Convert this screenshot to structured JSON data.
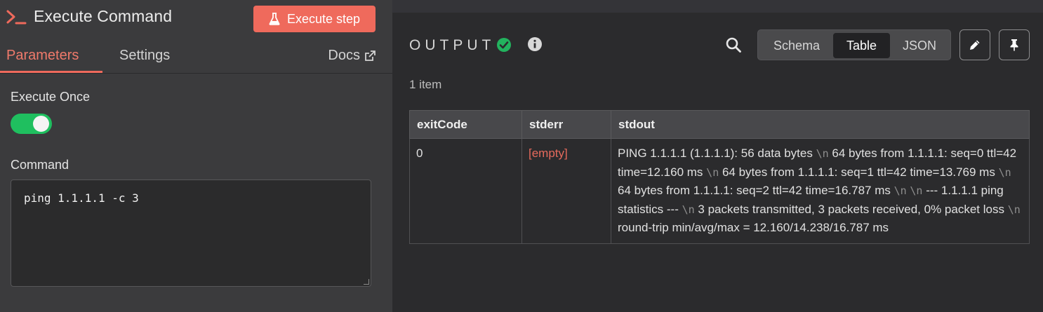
{
  "node": {
    "title": "Execute Command",
    "execute_button": "Execute step"
  },
  "tabs": {
    "parameters": "Parameters",
    "settings": "Settings",
    "docs": "Docs"
  },
  "params": {
    "execute_once_label": "Execute Once",
    "execute_once_enabled": true,
    "command_label": "Command",
    "command_value": "ping 1.1.1.1 -c 3"
  },
  "output": {
    "title": "OUTPUT",
    "views": [
      "Schema",
      "Table",
      "JSON"
    ],
    "active_view": "Table",
    "item_count": "1 item",
    "table": {
      "headers": [
        "exitCode",
        "stderr",
        "stdout"
      ],
      "rows": [
        {
          "exitCode": "0",
          "stderr": "[empty]",
          "stdout_lines": [
            "PING 1.1.1.1 (1.1.1.1): 56 data bytes",
            "64 bytes from 1.1.1.1: seq=0 ttl=42 time=12.160 ms",
            "64 bytes from 1.1.1.1: seq=1 ttl=42 time=13.769 ms",
            "64 bytes from 1.1.1.1: seq=2 ttl=42 time=16.787 ms",
            "",
            "--- 1.1.1.1 ping statistics ---",
            "3 packets transmitted, 3 packets received, 0% packet loss",
            "round-trip min/avg/max = 12.160/14.238/16.787 ms"
          ]
        }
      ]
    }
  },
  "colors": {
    "accent": "#ef6a5c",
    "toggle_on": "#1fbf5f",
    "success": "#22b35e"
  }
}
